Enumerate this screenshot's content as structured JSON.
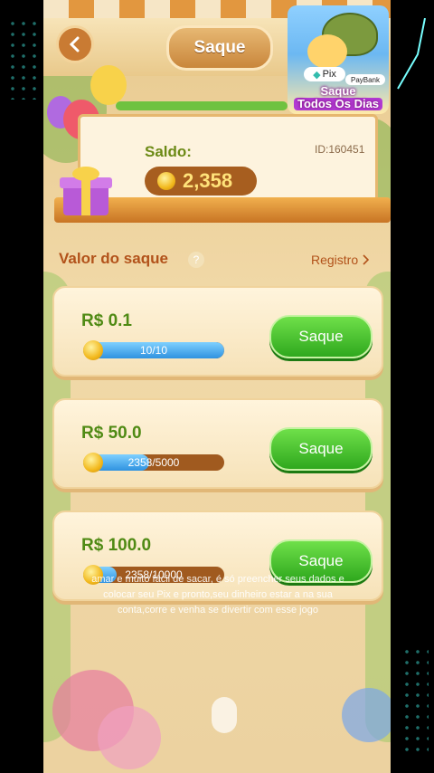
{
  "header": {
    "title": "Saque"
  },
  "promo": {
    "pix_label": "Pix",
    "paybank_label": "PayBank",
    "line1": "Saque",
    "line2": "Todos Os Dias"
  },
  "balance": {
    "saldo_label": "Saldo:",
    "id_label": "ID:160451",
    "amount": "2,358"
  },
  "withdraw": {
    "section_title": "Valor do saque",
    "help": "?",
    "registro_label": "Registro",
    "options": [
      {
        "amount": "R$ 0.1",
        "progress": "10/10",
        "progress_fraction": 1.0,
        "button": "Saque"
      },
      {
        "amount": "R$ 50.0",
        "progress": "2358/5000",
        "progress_fraction": 0.47,
        "button": "Saque"
      },
      {
        "amount": "R$ 100.0",
        "progress": "2358/10000",
        "progress_fraction": 0.24,
        "button": "Saque"
      }
    ]
  },
  "caption": "amar e muito fácil de sacar, é só preencher seus dados e colocar seu Pix e pronto,seu dinheiro estar a na sua conta,corre e venha se divertir com esse jogo",
  "colors": {
    "accent_orange": "#b2521a",
    "button_green": "#2fa81e",
    "amount_green": "#4f8a14",
    "coin_gold": "#f2b81c"
  }
}
